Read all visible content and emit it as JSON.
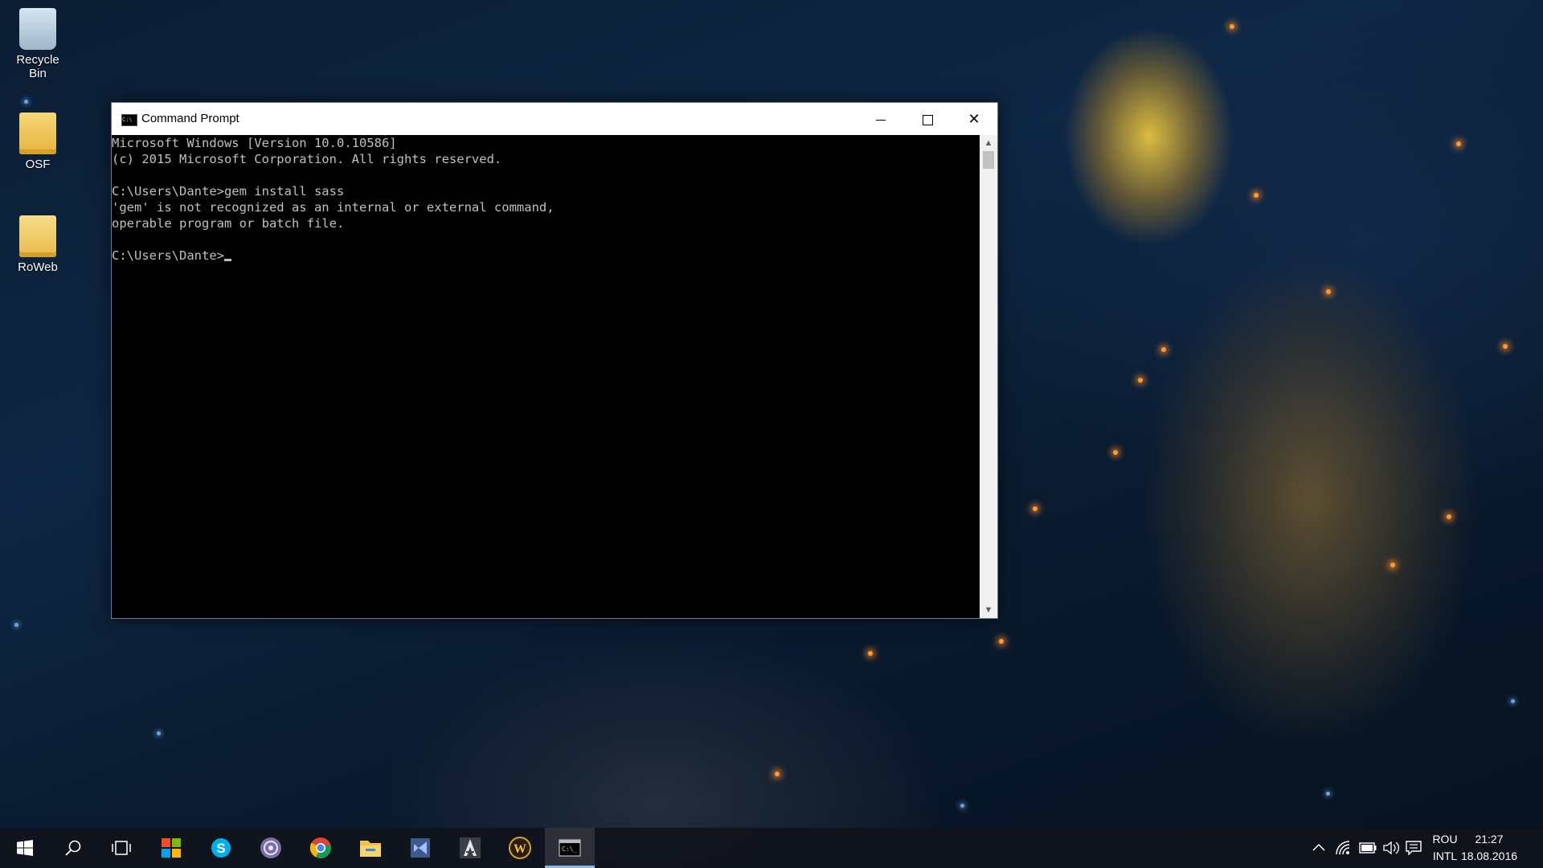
{
  "desktop": {
    "icons": [
      {
        "label": "Recycle Bin",
        "icon": "recycle-bin-icon"
      },
      {
        "label": "OSF",
        "icon": "folder-icon"
      },
      {
        "label": "RoWeb",
        "icon": "folder-icon"
      }
    ]
  },
  "window": {
    "title": "Command Prompt",
    "controls": {
      "minimize": "minimize-icon",
      "maximize": "maximize-icon",
      "close": "close-icon"
    },
    "console_lines": [
      "Microsoft Windows [Version 10.0.10586]",
      "(c) 2015 Microsoft Corporation. All rights reserved.",
      "",
      "C:\\Users\\Dante>gem install sass",
      "'gem' is not recognized as an internal or external command,",
      "operable program or batch file.",
      "",
      "C:\\Users\\Dante>"
    ]
  },
  "taskbar": {
    "items": [
      {
        "name": "start-button",
        "icon": "windows-logo-icon"
      },
      {
        "name": "search-button",
        "icon": "search-icon"
      },
      {
        "name": "task-view-button",
        "icon": "task-view-icon"
      },
      {
        "name": "store-app",
        "icon": "windows-store-icon"
      },
      {
        "name": "skype-app",
        "icon": "skype-icon"
      },
      {
        "name": "torrent-app",
        "icon": "torrent-icon"
      },
      {
        "name": "chrome-app",
        "icon": "chrome-icon"
      },
      {
        "name": "file-explorer-app",
        "icon": "folder-icon"
      },
      {
        "name": "visual-studio-app",
        "icon": "visual-studio-icon"
      },
      {
        "name": "assassins-creed-app",
        "icon": "assassins-creed-icon"
      },
      {
        "name": "world-of-warcraft-app",
        "icon": "wow-icon"
      },
      {
        "name": "command-prompt-app",
        "icon": "cmd-icon",
        "active": true
      }
    ],
    "tray": {
      "icons": [
        "chevron-up-icon",
        "wifi-icon",
        "battery-icon",
        "volume-icon",
        "action-center-icon"
      ],
      "language": {
        "top": "ROU",
        "bottom": "INTL"
      },
      "time": "21:27",
      "date": "18.08.2016"
    }
  },
  "colors": {
    "console_bg": "#000000",
    "console_fg": "#c0c0c0",
    "taskbar_accent": "#8cb6e6"
  }
}
